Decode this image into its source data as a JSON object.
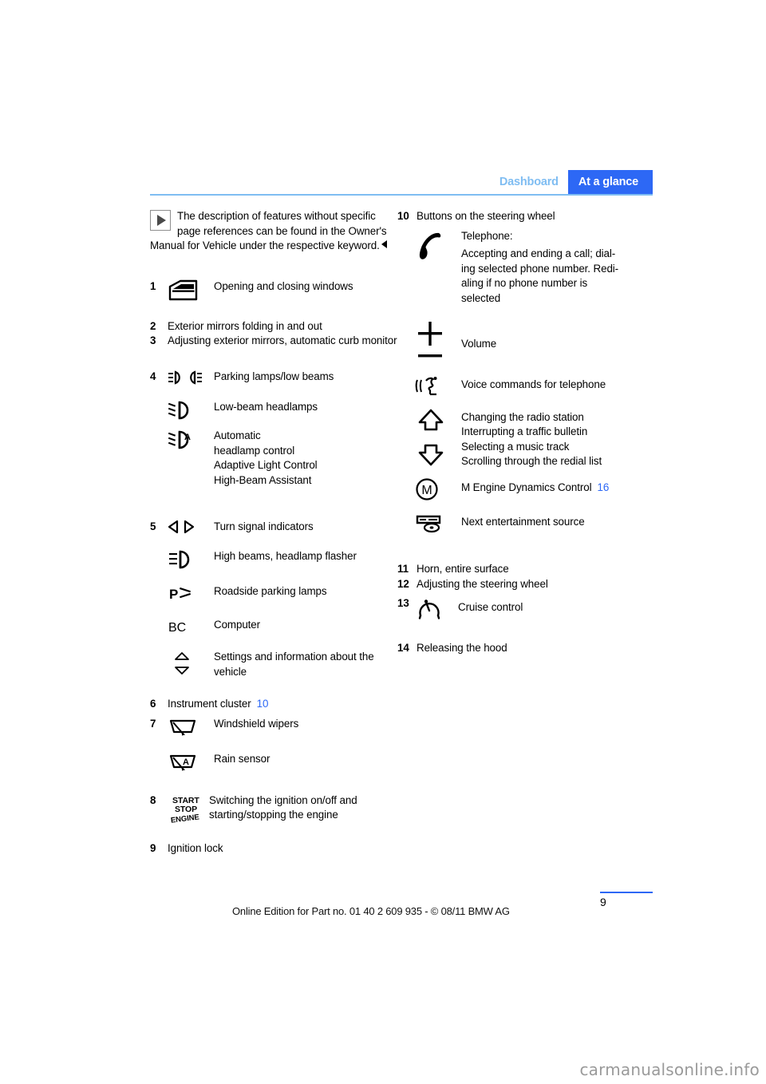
{
  "header": {
    "tab_inactive": "Dashboard",
    "tab_active": "At a glance",
    "accent_color": "#2d68f5",
    "rule_color": "#7fbdf2"
  },
  "note": {
    "icon": "note-triangle-icon",
    "text": "The description of features without specific page references can be found in the Owner's Manual for Vehicle under the respective keyword."
  },
  "left_column": {
    "item1": {
      "number": "1",
      "icon": "car-door-window-icon",
      "label": "Opening and closing windows"
    },
    "item2": {
      "number": "2",
      "label": "Exterior mirrors folding in and out"
    },
    "item3": {
      "number": "3",
      "label": "Adjusting exterior mirrors, automatic curb monitor"
    },
    "item4": {
      "number": "4",
      "subitems": [
        {
          "icon": "parking-lamps-low-beams-icon",
          "label": "Parking lamps/low beams"
        },
        {
          "icon": "low-beam-headlamp-icon",
          "label": "Low-beam headlamps"
        },
        {
          "icon": "automatic-headlamp-control-icon",
          "label": "Automatic\nheadlamp control\nAdaptive Light Control\nHigh-Beam Assistant"
        }
      ]
    },
    "item5": {
      "number": "5",
      "subitems": [
        {
          "icon": "turn-signal-icon",
          "label": "Turn signal indicators"
        },
        {
          "icon": "high-beam-icon",
          "label": "High beams, headlamp flasher"
        },
        {
          "icon": "roadside-parking-lamps-icon",
          "label": "Roadside parking lamps"
        },
        {
          "icon": "bc-computer-icon",
          "label": "Computer"
        },
        {
          "icon": "up-down-triangle-icon",
          "label": "Settings and information about the vehicle"
        }
      ]
    },
    "item6": {
      "number": "6",
      "label": "Instrument cluster",
      "page_ref": "10"
    },
    "item7": {
      "number": "7",
      "subitems": [
        {
          "icon": "windshield-wiper-icon",
          "label": "Windshield wipers"
        },
        {
          "icon": "rain-sensor-icon",
          "label": "Rain sensor"
        }
      ]
    },
    "item8": {
      "number": "8",
      "icon": "start-stop-engine-icon",
      "icon_text": [
        "START",
        "STOP",
        "ENGINE"
      ],
      "label": "Switching the ignition on/off and starting/stopping the engine"
    },
    "item9": {
      "number": "9",
      "label": "Ignition lock"
    }
  },
  "right_column": {
    "item10": {
      "number": "10",
      "label": "Buttons on the steering wheel",
      "subitems": [
        {
          "icon": "telephone-handset-icon",
          "label": "Telephone:",
          "label2": "Accepting and ending a call; dialing selected phone number. Redialing if no phone number is selected"
        },
        {
          "icon": "plus-minus-volume-icon",
          "label": "Volume"
        },
        {
          "icon": "voice-command-icon",
          "label": "Voice commands for telephone"
        },
        {
          "icon": "up-down-arrow-icon",
          "label": "Changing the radio station\nInterrupting a traffic bulletin\nSelecting a music track\nScrolling through the redial list"
        },
        {
          "icon": "m-engine-dynamics-icon",
          "label": "M Engine Dynamics Control",
          "page_ref": "16"
        },
        {
          "icon": "entertainment-source-icon",
          "label": "Next entertainment source"
        }
      ]
    },
    "item11": {
      "number": "11",
      "label": "Horn, entire surface"
    },
    "item12": {
      "number": "12",
      "label": "Adjusting the steering wheel"
    },
    "item13": {
      "number": "13",
      "icon": "cruise-control-icon",
      "label": "Cruise control"
    },
    "item14": {
      "number": "14",
      "label": "Releasing the hood"
    }
  },
  "footer": {
    "page_number": "9",
    "online_edition": "Online Edition for Part no. 01 40 2 609 935 - © 08/11 BMW AG",
    "watermark": "carmanualsonline.info"
  }
}
